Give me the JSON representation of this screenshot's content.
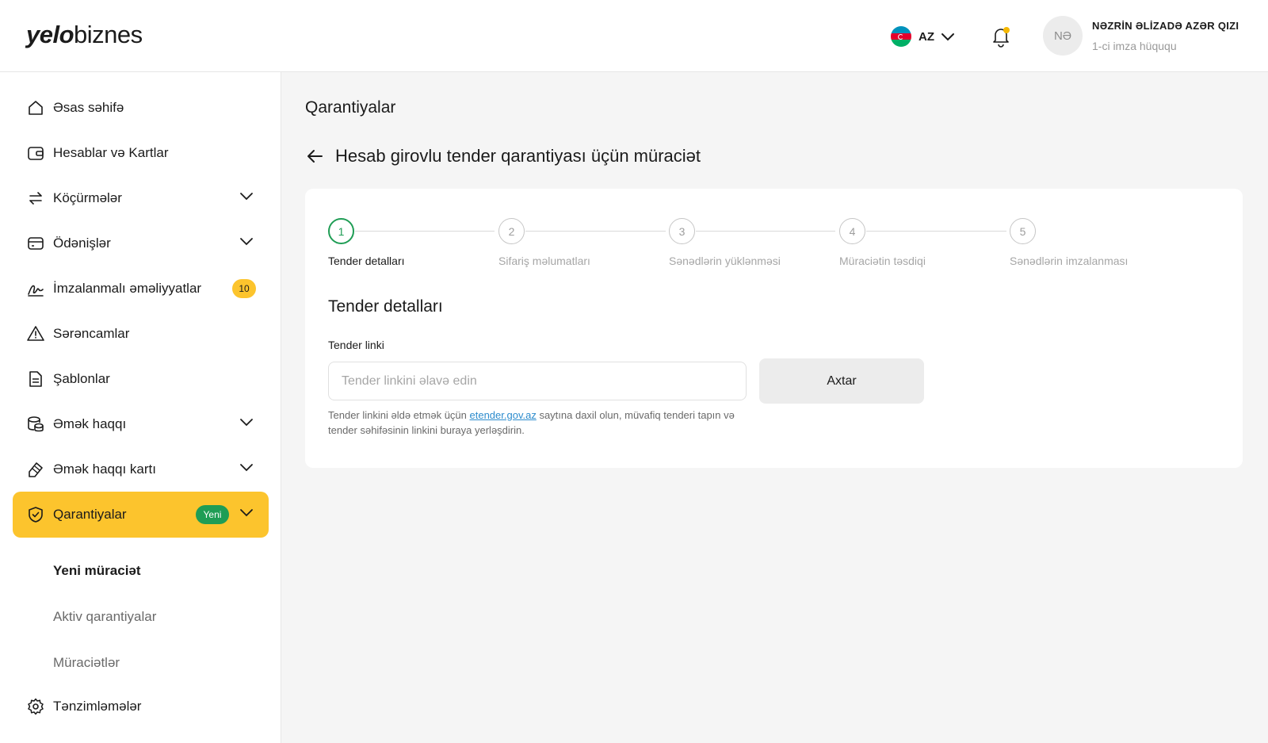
{
  "header": {
    "logo_bold": "yelo",
    "logo_light": "biznes",
    "language": "AZ",
    "user_initials": "NƏ",
    "user_name": "NƏZRİN ƏLİZADƏ AZƏR QIZI",
    "user_role": "1-ci imza hüququ"
  },
  "sidebar": {
    "items": [
      {
        "label": "Əsas səhifə",
        "icon": "home-icon"
      },
      {
        "label": "Hesablar və Kartlar",
        "icon": "wallet-icon"
      },
      {
        "label": "Köçürmələr",
        "icon": "transfer-icon",
        "expandable": true
      },
      {
        "label": "Ödənişlər",
        "icon": "payment-card-icon",
        "expandable": true
      },
      {
        "label": "İmzalanmalı əməliyyatlar",
        "icon": "signature-icon",
        "badge": "10"
      },
      {
        "label": "Sərəncamlar",
        "icon": "warning-icon"
      },
      {
        "label": "Şablonlar",
        "icon": "document-icon"
      },
      {
        "label": "Əmək haqqı",
        "icon": "coins-icon",
        "expandable": true
      },
      {
        "label": "Əmək haqqı kartı",
        "icon": "card-edit-icon",
        "expandable": true
      },
      {
        "label": "Qarantiyalar",
        "icon": "shield-icon",
        "expandable": true,
        "active": true,
        "badge": "Yeni"
      },
      {
        "label": "Tənzimləmələr",
        "icon": "gear-icon"
      }
    ],
    "sub_items": [
      "Yeni müraciət",
      "Aktiv qarantiyalar",
      "Müraciətlər"
    ]
  },
  "main": {
    "page_title": "Qarantiyalar",
    "form_title": "Hesab girovlu tender qarantiyası üçün müraciət",
    "steps": [
      {
        "number": "1",
        "label": "Tender detalları"
      },
      {
        "number": "2",
        "label": "Sifariş məlumatları"
      },
      {
        "number": "3",
        "label": "Sənədlərin yüklənməsi"
      },
      {
        "number": "4",
        "label": "Müraciətin təsdiqi"
      },
      {
        "number": "5",
        "label": "Sənədlərin imzalanması"
      }
    ],
    "active_step": 1,
    "section_title": "Tender detalları",
    "field_label": "Tender linki",
    "field_placeholder": "Tender linkini əlavə edin",
    "field_value": "",
    "search_button": "Axtar",
    "hint_before": "Tender linkini əldə etmək üçün ",
    "hint_link": "etender.gov.az",
    "hint_after": " saytına daxil olun, müvafiq tenderi tapın və tender səhifəsinin linkini buraya yerləşdirin."
  },
  "colors": {
    "accent": "#fcc42d",
    "success": "#1f9d55",
    "link": "#2d8ccd"
  }
}
